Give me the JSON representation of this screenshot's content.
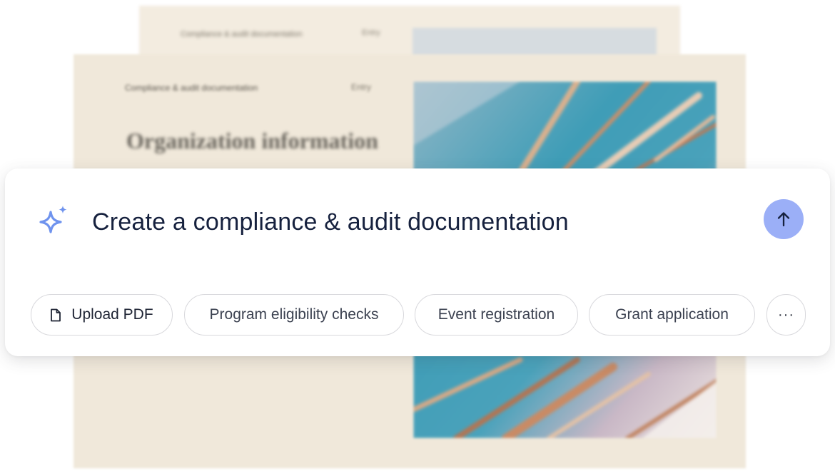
{
  "background_docs": {
    "back": {
      "breadcrumb": "Compliance & audit documentation",
      "meta": "Entry"
    },
    "front": {
      "breadcrumb": "Compliance & audit documentation",
      "meta": "Entry",
      "heading": "Organization information"
    }
  },
  "prompt": {
    "icon": "sparkle-icon",
    "text": "Create a compliance & audit documentation",
    "send_icon": "arrow-up-icon"
  },
  "suggestions": [
    {
      "label": "Upload PDF",
      "icon": "file-icon"
    },
    {
      "label": "Program eligibility checks"
    },
    {
      "label": "Event registration"
    },
    {
      "label": "Grant application"
    }
  ],
  "more_label": "···",
  "colors": {
    "accent": "#9baff7",
    "sparkle": "#6f93ee",
    "prompt_text": "#16213e",
    "doc_background": "#f0e8da",
    "art_blue": "#4e9fb8"
  }
}
